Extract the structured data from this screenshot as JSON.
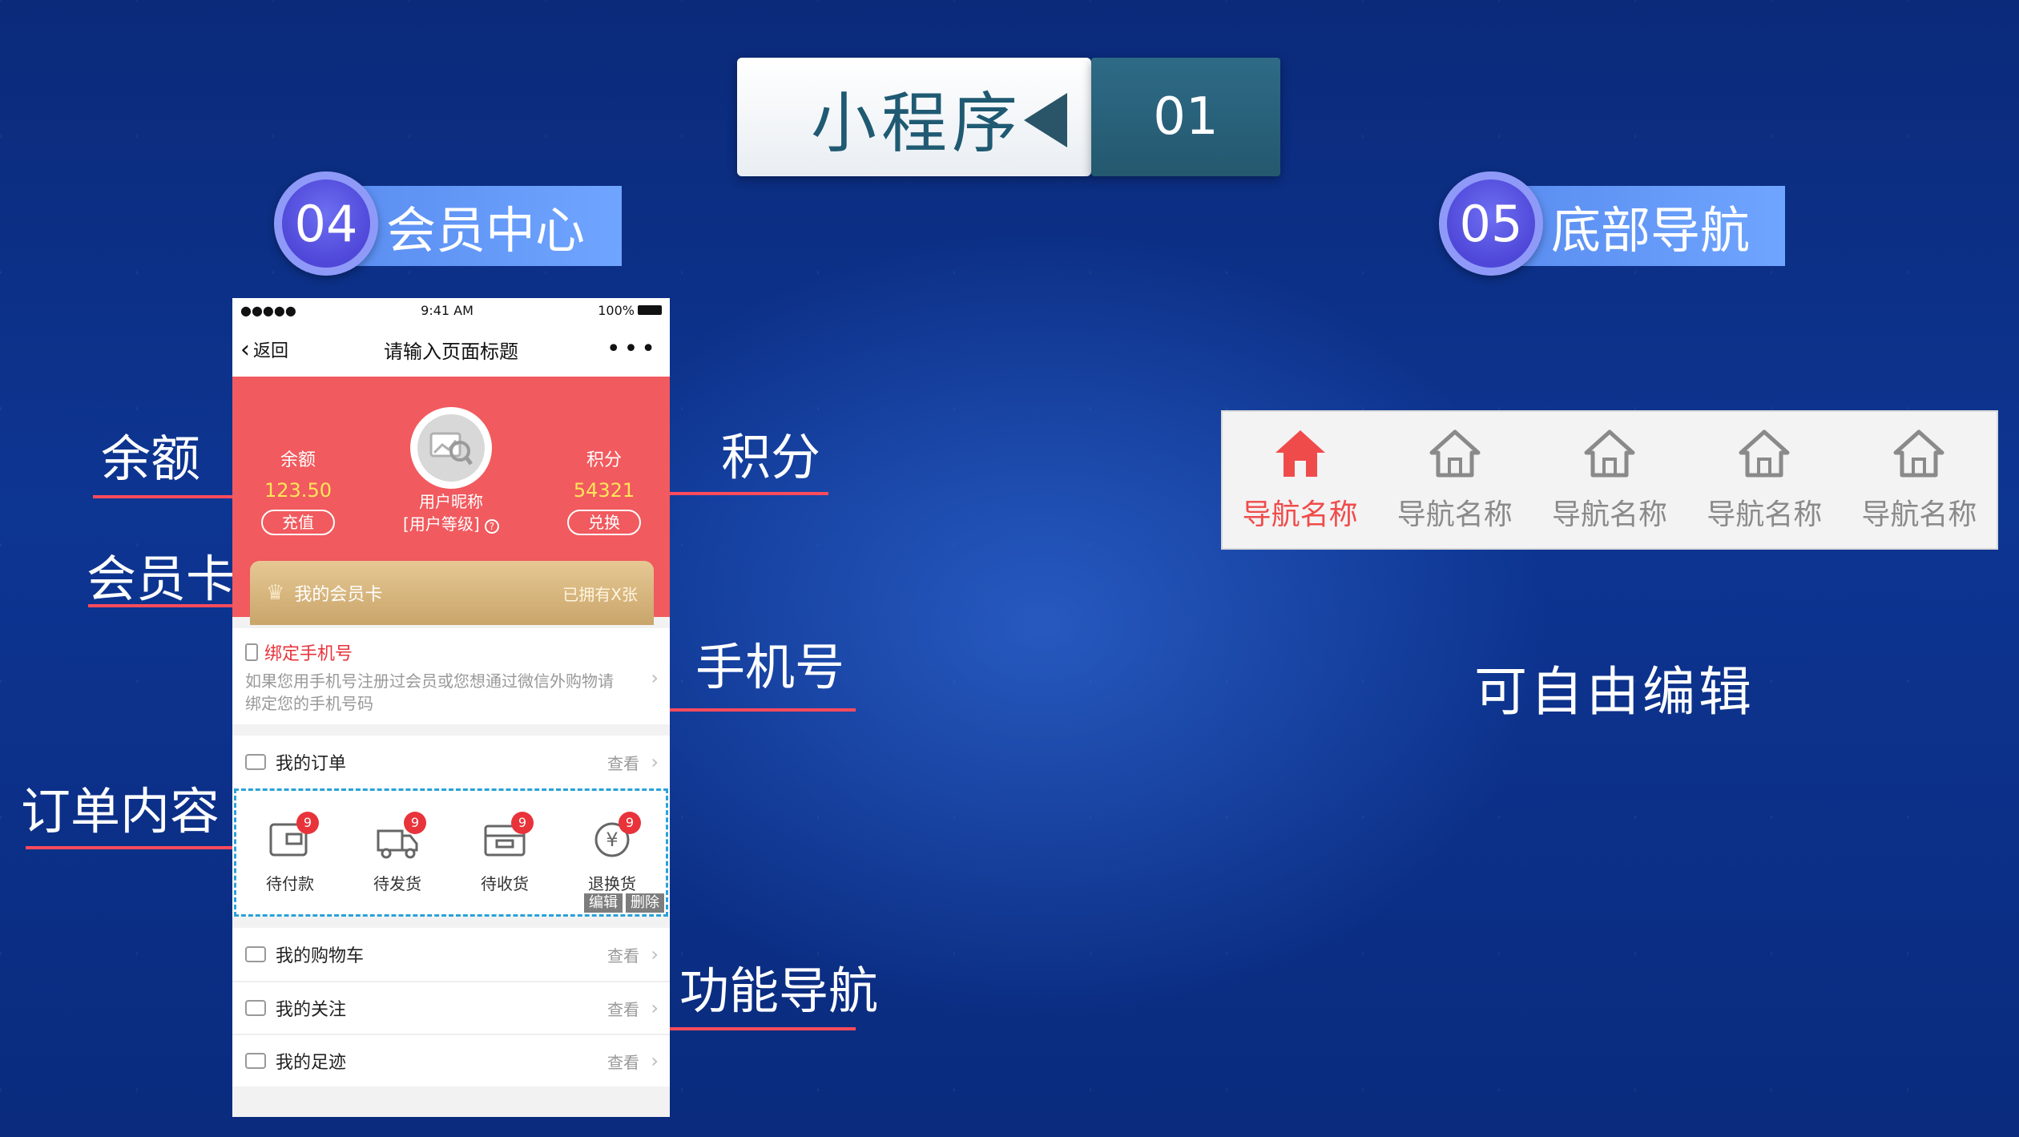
{
  "header": {
    "title": "小程序",
    "number": "01"
  },
  "sections": {
    "left": {
      "number": "04",
      "label": "会员中心"
    },
    "right": {
      "number": "05",
      "label": "底部导航"
    }
  },
  "annotations": {
    "balance": "余额",
    "member_card": "会员卡",
    "order_content": "订单内容",
    "points": "积分",
    "phone": "手机号",
    "function_nav": "功能导航"
  },
  "phone": {
    "status": {
      "signal": "●●●●●",
      "time": "9:41 AM",
      "battery": "100%"
    },
    "nav": {
      "back": "返回",
      "title": "请输入页面标题",
      "more": "•••"
    },
    "balance": {
      "label": "余额",
      "value": "123.50",
      "button": "充值"
    },
    "points": {
      "label": "积分",
      "value": "54321",
      "button": "兑换"
    },
    "user": {
      "nickname": "用户昵称",
      "level": "[用户等级]"
    },
    "member_card": {
      "title": "我的会员卡",
      "count": "已拥有X张"
    },
    "bind_phone": {
      "title": "绑定手机号",
      "desc": "如果您用手机号注册过会员或您想通过微信外购物请绑定您的手机号码"
    },
    "orders": {
      "title": "我的订单",
      "more": "查看",
      "items": [
        {
          "label": "待付款",
          "badge": "9",
          "icon": "wallet-icon"
        },
        {
          "label": "待发货",
          "badge": "9",
          "icon": "truck-icon"
        },
        {
          "label": "待收货",
          "badge": "9",
          "icon": "box-icon"
        },
        {
          "label": "退换货",
          "badge": "9",
          "icon": "refund-icon"
        }
      ],
      "edit": "编辑",
      "delete": "删除"
    },
    "menu": [
      {
        "label": "我的购物车",
        "more": "查看"
      },
      {
        "label": "我的关注",
        "more": "查看"
      },
      {
        "label": "我的足迹",
        "more": "查看"
      }
    ]
  },
  "tabbar": {
    "items": [
      {
        "label": "导航名称",
        "active": true
      },
      {
        "label": "导航名称",
        "active": false
      },
      {
        "label": "导航名称",
        "active": false
      },
      {
        "label": "导航名称",
        "active": false
      },
      {
        "label": "导航名称",
        "active": false
      }
    ],
    "active_color": "#f04b4b",
    "inactive_color": "#8a8a8a"
  },
  "free_edit": "可自由编辑"
}
